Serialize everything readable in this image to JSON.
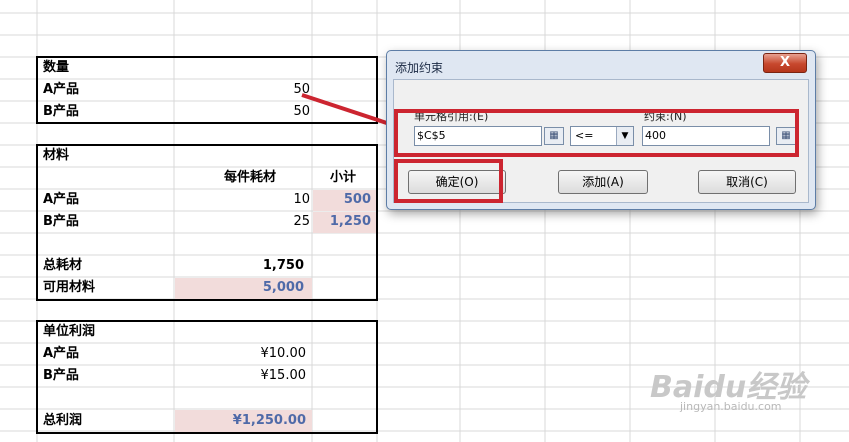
{
  "sheet": {
    "quantity": {
      "header": "数量",
      "rows": [
        {
          "name": "A产品",
          "value": "50"
        },
        {
          "name": "B产品",
          "value": "50"
        }
      ]
    },
    "material": {
      "header": "材料",
      "col_per_unit": "每件耗材",
      "col_subtotal": "小计",
      "rows": [
        {
          "name": "A产品",
          "per_unit": "10",
          "subtotal": "500"
        },
        {
          "name": "B产品",
          "per_unit": "25",
          "subtotal": "1,250"
        }
      ],
      "total_label": "总耗材",
      "total_value": "1,750",
      "available_label": "可用材料",
      "available_value": "5,000"
    },
    "profit": {
      "header": "单位利润",
      "rows": [
        {
          "name": "A产品",
          "value": "¥10.00"
        },
        {
          "name": "B产品",
          "value": "¥15.00"
        }
      ],
      "total_label": "总利润",
      "total_value": "¥1,250.00"
    }
  },
  "dialog": {
    "title": "添加约束",
    "close_symbol": "X",
    "cell_ref_label": "单元格引用:(E)",
    "cell_ref_value": "$C$5",
    "operator_value": "<=",
    "constraint_label": "约束:(N)",
    "constraint_value": "400",
    "ok_label": "确定(O)",
    "add_label": "添加(A)",
    "cancel_label": "取消(C)"
  },
  "watermark": {
    "logo": "Baidu经验",
    "url": "jingyan.baidu.com"
  },
  "colors": {
    "highlight": "#cc2530",
    "pink_fill": "#f2dcdb",
    "blue_value": "#4f6aa8"
  }
}
